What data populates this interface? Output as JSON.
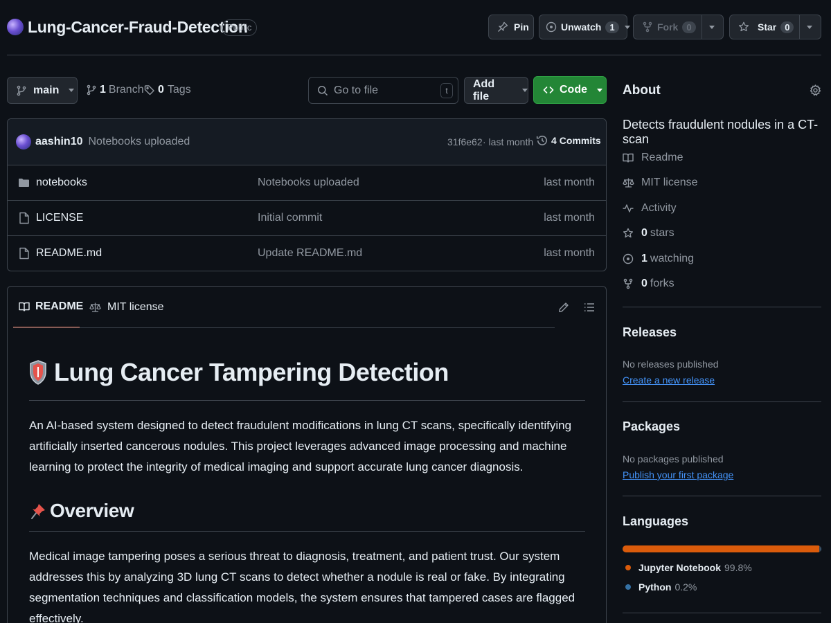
{
  "repo": {
    "name": "Lung-Cancer-Fraud-Detection",
    "visibility": "Public"
  },
  "actions": {
    "pin_label": "Pin",
    "unwatch_label": "Unwatch",
    "watch_count": "1",
    "fork_label": "Fork",
    "fork_count": "0",
    "star_label": "Star",
    "star_count": "0"
  },
  "toolbar": {
    "branch": "main",
    "branch_count": "1",
    "branch_label": "Branch",
    "tag_count": "0",
    "tag_label": "Tags",
    "search_placeholder": "Go to file",
    "search_shortcut": "t",
    "add_file_label": "Add file",
    "code_label": "Code"
  },
  "commit": {
    "author": "aashin10",
    "message": "Notebooks uploaded",
    "hash": "31f6e62",
    "time": "· last month",
    "commits_count": "4",
    "commits_label": "Commits"
  },
  "files": [
    {
      "name": "notebooks",
      "type": "folder",
      "message": "Notebooks uploaded",
      "time": "last month"
    },
    {
      "name": "LICENSE",
      "type": "file",
      "message": "Initial commit",
      "time": "last month"
    },
    {
      "name": "README.md",
      "type": "file",
      "message": "Update README.md",
      "time": "last month"
    }
  ],
  "readme_tabs": {
    "readme": "README",
    "license": "MIT license"
  },
  "readme": {
    "title_emoji": "🛡️",
    "title": "Lung Cancer Tampering Detection",
    "intro": "An AI-based system designed to detect fraudulent modifications in lung CT scans, specifically identifying artificially inserted cancerous nodules. This project leverages advanced image processing and machine learning to protect the integrity of medical imaging and support accurate lung cancer diagnosis.",
    "overview_emoji": "📌",
    "overview_heading": "Overview",
    "overview_text": "Medical image tampering poses a serious threat to diagnosis, treatment, and patient trust. Our system addresses this by analyzing 3D lung CT scans to detect whether a nodule is real or fake. By integrating segmentation techniques and classification models, the system ensures that tampered cases are flagged effectively."
  },
  "about": {
    "heading": "About",
    "description": "Detects fraudulent nodules in a CT-scan",
    "readme": "Readme",
    "license": "MIT license",
    "activity": "Activity",
    "stars_count": "0",
    "stars_label": "stars",
    "watching_count": "1",
    "watching_label": "watching",
    "forks_count": "0",
    "forks_label": "forks"
  },
  "releases": {
    "heading": "Releases",
    "empty": "No releases published",
    "link": "Create a new release"
  },
  "packages": {
    "heading": "Packages",
    "empty": "No packages published",
    "link": "Publish your first package"
  },
  "languages": {
    "heading": "Languages",
    "items": [
      {
        "name": "Jupyter Notebook",
        "percent": "99.8%",
        "value": 99.8,
        "color": "#DA5B0B"
      },
      {
        "name": "Python",
        "percent": "0.2%",
        "value": 0.2,
        "color": "#3572A5"
      }
    ]
  }
}
